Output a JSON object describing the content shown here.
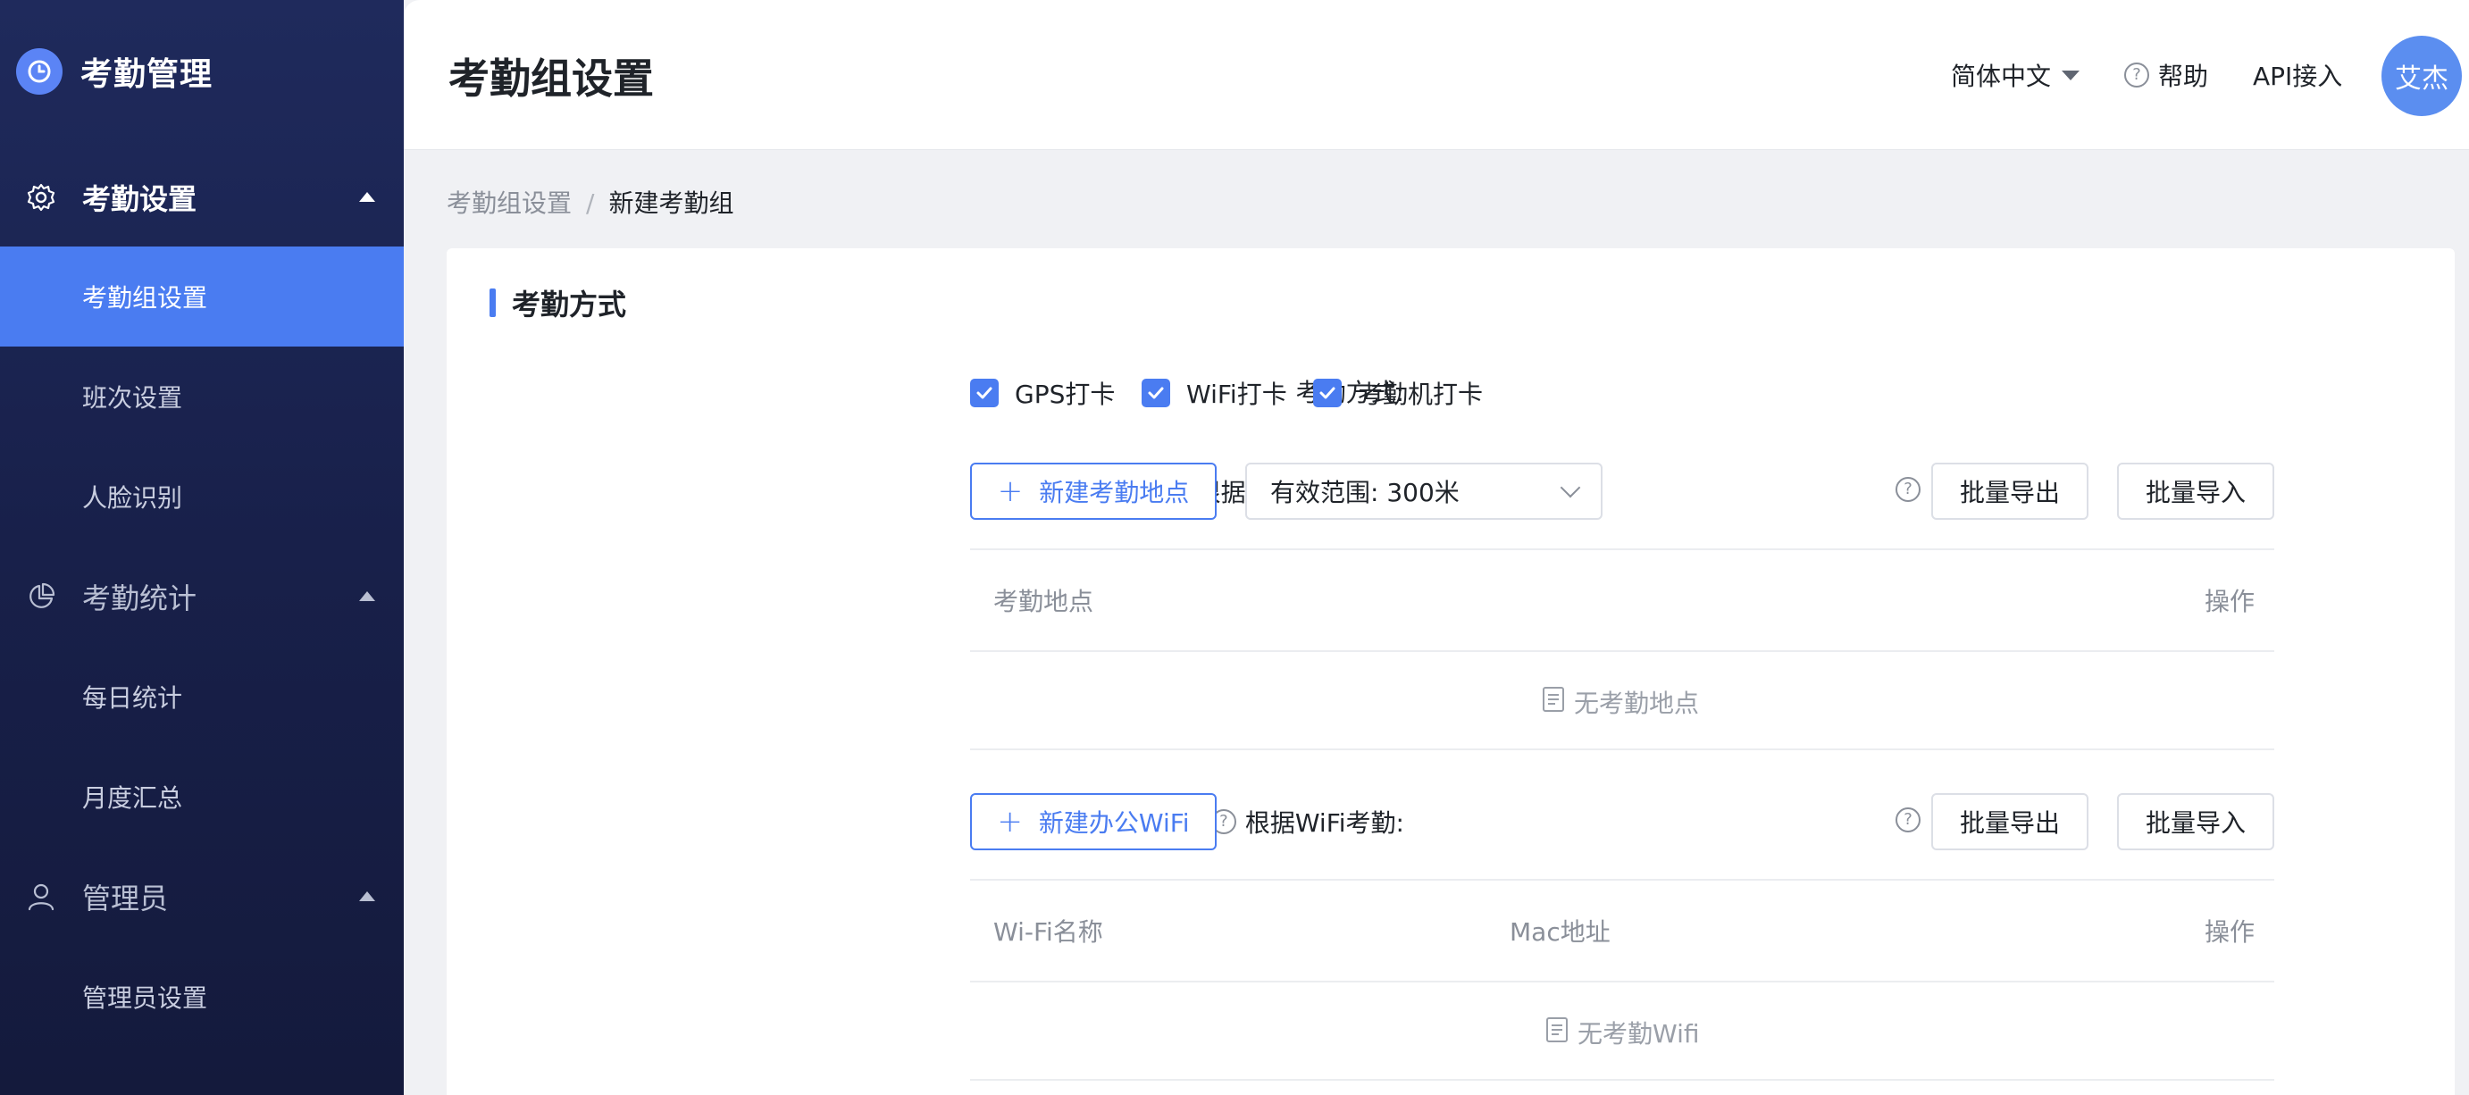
{
  "sidebar": {
    "brand": "考勤管理",
    "groups": [
      {
        "label": "考勤设置",
        "items": [
          "考勤组设置",
          "班次设置",
          "人脸识别"
        ]
      },
      {
        "label": "考勤统计",
        "items": [
          "每日统计",
          "月度汇总"
        ]
      },
      {
        "label": "管理员",
        "items": [
          "管理员设置"
        ]
      }
    ],
    "active_item": "考勤组设置"
  },
  "header": {
    "title": "考勤组设置",
    "language": "简体中文",
    "help": "帮助",
    "api": "API接入",
    "avatar": "艾杰"
  },
  "breadcrumb": {
    "parent": "考勤组设置",
    "separator": "/",
    "current": "新建考勤组"
  },
  "section": {
    "title": "考勤方式",
    "method_label": "考勤方式:",
    "methods": [
      "GPS打卡",
      "WiFi打卡",
      "考勤机打卡"
    ],
    "location": {
      "label": "根据办公地点考勤:",
      "add_button": "新建考勤地点",
      "range_select": "有效范围: 300米",
      "export": "批量导出",
      "import": "批量导入",
      "columns": [
        "考勤地点",
        "操作"
      ],
      "empty": "无考勤地点"
    },
    "wifi": {
      "label": "根据WiFi考勤:",
      "add_button": "新建办公WiFi",
      "export": "批量导出",
      "import": "批量导入",
      "columns": [
        "Wi-Fi名称",
        "Mac地址",
        "操作"
      ],
      "empty": "无考勤Wifi"
    }
  },
  "colors": {
    "accent": "#4a7cf1",
    "sidebar_bg": "#1f2a5c"
  }
}
